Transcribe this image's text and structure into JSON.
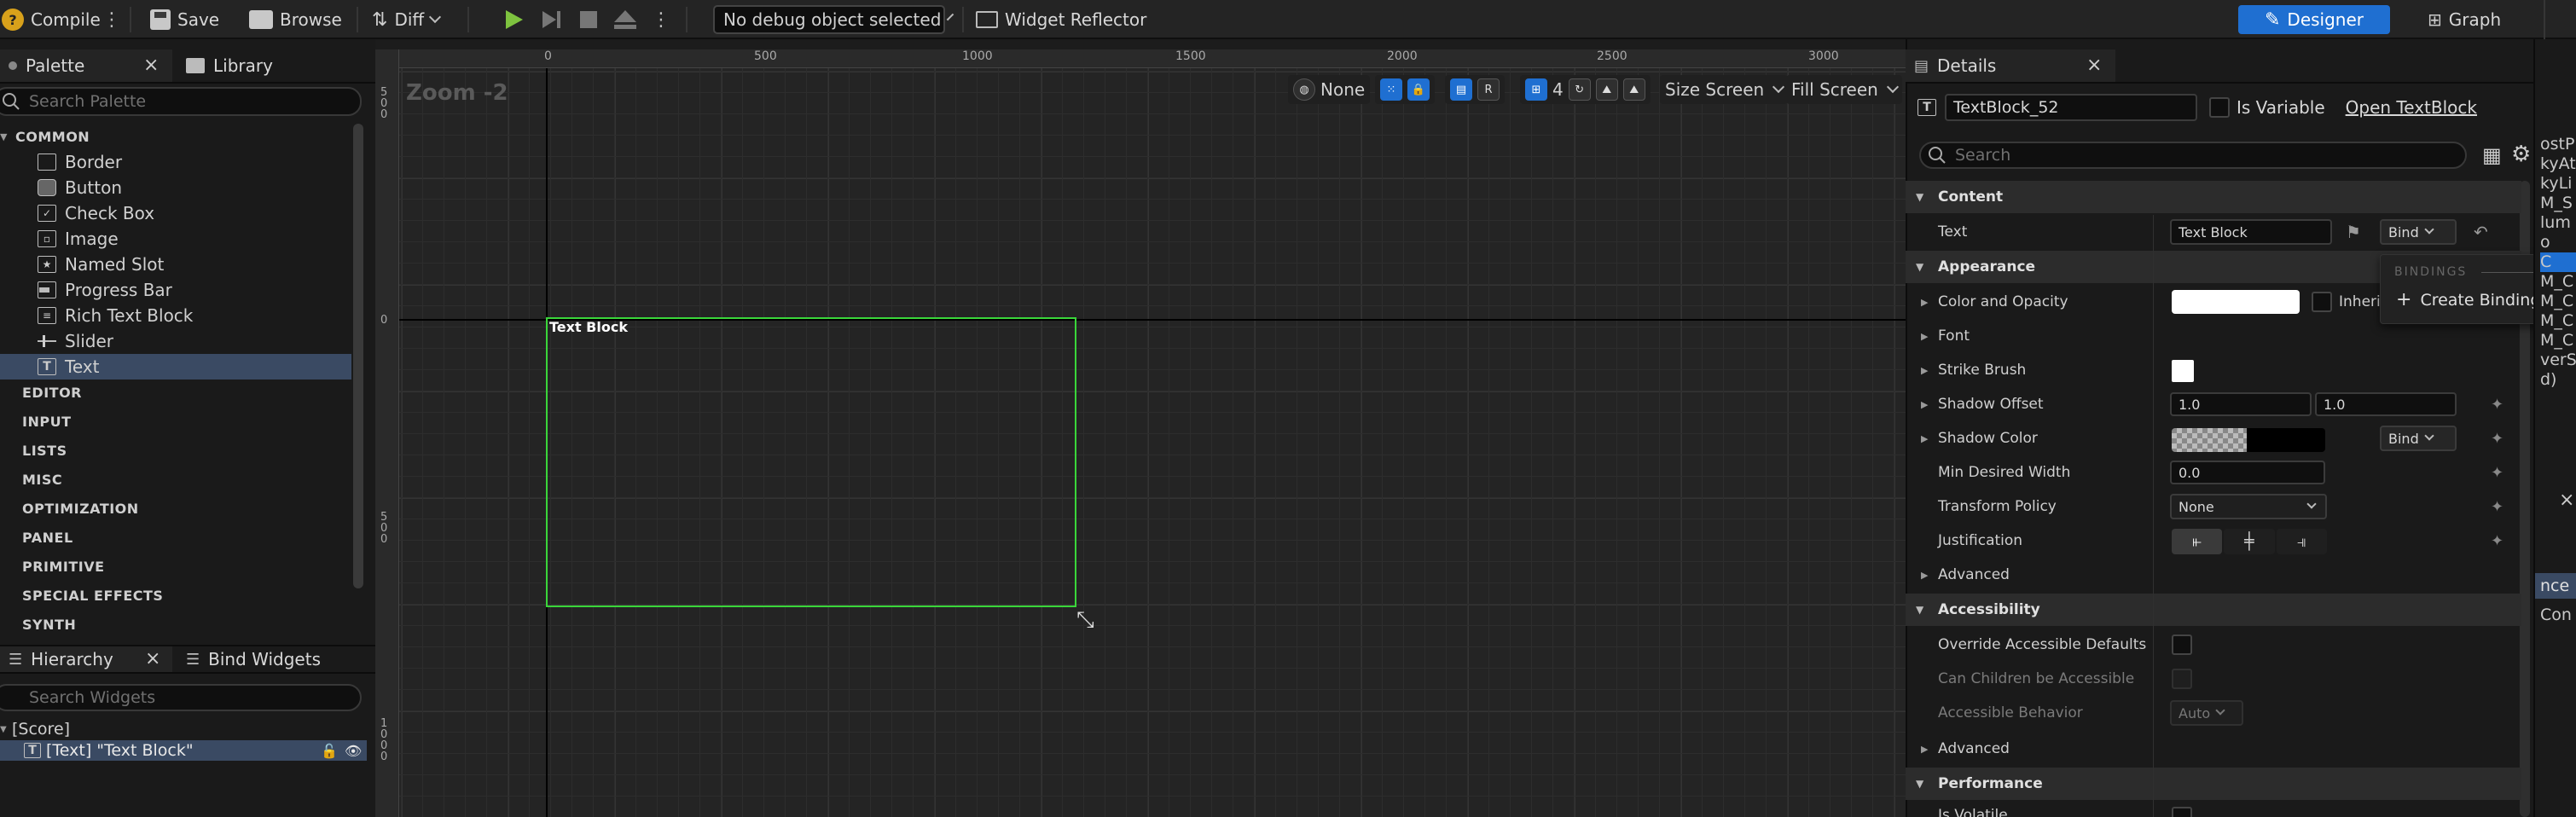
{
  "toolbar": {
    "compile": "Compile",
    "save": "Save",
    "browse": "Browse",
    "diff": "Diff",
    "debug_select": "No debug object selected",
    "widget_reflector": "Widget Reflector",
    "designer": "Designer",
    "graph": "Graph"
  },
  "palette": {
    "tab": "Palette",
    "library_tab": "Library",
    "search_placeholder": "Search Palette",
    "categories": [
      "COMMON",
      "EDITOR",
      "INPUT",
      "LISTS",
      "MISC",
      "OPTIMIZATION",
      "PANEL",
      "PRIMITIVE",
      "SPECIAL EFFECTS",
      "SYNTH"
    ],
    "items": [
      "Border",
      "Button",
      "Check Box",
      "Image",
      "Named Slot",
      "Progress Bar",
      "Rich Text Block",
      "Slider",
      "Text"
    ],
    "selected": "Text"
  },
  "hierarchy": {
    "tab": "Hierarchy",
    "bind_tab": "Bind Widgets",
    "search_placeholder": "Search Widgets",
    "root": "[Score]",
    "child": "[Text] \"Text Block\""
  },
  "viewport": {
    "zoom": "Zoom -2",
    "ruler_x": [
      "0",
      "500",
      "1000",
      "1500",
      "2000",
      "2500",
      "3000"
    ],
    "ruler_y_0": "0",
    "ruler_y_500": "500",
    "ruler_y_1000": "1000",
    "ruler_y_top": "500",
    "widget_label": "Text Block",
    "none_label": "None",
    "r_label": "R",
    "grid_count": "4",
    "size_screen": "Size Screen",
    "fill_screen": "Fill Screen"
  },
  "details": {
    "tab": "Details",
    "name_value": "TextBlock_52",
    "is_variable": "Is Variable",
    "open_link": "Open TextBlock",
    "search_placeholder": "Search",
    "sections": {
      "content": "Content",
      "appearance": "Appearance",
      "accessibility": "Accessibility",
      "performance": "Performance"
    },
    "text_label": "Text",
    "text_value": "Text Block",
    "bind": "Bind",
    "color_opacity": "Color and Opacity",
    "inherit": "Inherit",
    "font": "Font",
    "strike_brush": "Strike Brush",
    "shadow_offset": "Shadow Offset",
    "shadow_offset_x": "1.0",
    "shadow_offset_y": "1.0",
    "shadow_color": "Shadow Color",
    "min_desired_width": "Min Desired Width",
    "min_desired_width_value": "0.0",
    "transform_policy": "Transform Policy",
    "transform_policy_value": "None",
    "justification": "Justification",
    "advanced": "Advanced",
    "override_accessible": "Override Accessible Defaults",
    "can_children": "Can Children be Accessible",
    "accessible_behavior": "Accessible Behavior",
    "accessible_behavior_value": "Auto",
    "advanced2": "Advanced",
    "is_volatile": "Is Volatile"
  },
  "bindings_popup": {
    "header": "BINDINGS",
    "create": "Create Binding"
  },
  "right_clip": {
    "lines": [
      "ostP",
      "kyAt",
      "kyLi",
      "M_S",
      "lum",
      "o",
      "C",
      "M_C",
      "M_C",
      "M_C",
      "M_C",
      "verS",
      "d)"
    ],
    "x": "×",
    "lines2": [
      "nce",
      "Con"
    ]
  },
  "colors": {
    "accent": "#1f6fd1",
    "selection": "#3a4a63",
    "widget_outline": "#3ad63a",
    "play": "#7ec33f"
  }
}
